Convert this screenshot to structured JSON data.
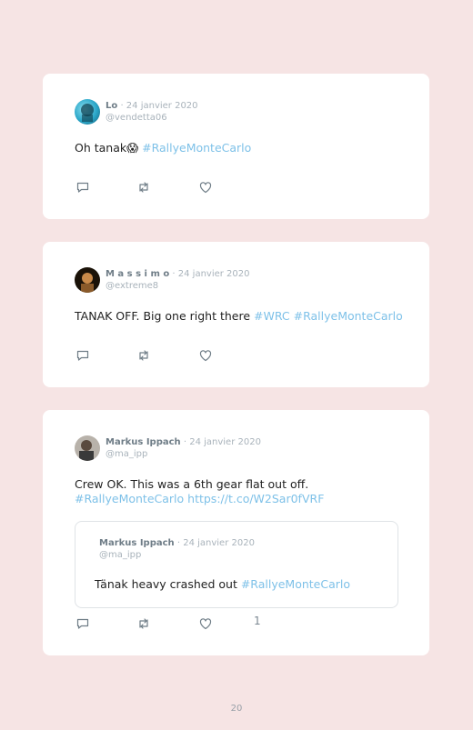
{
  "tweets": [
    {
      "name": "Lo",
      "date": "· 24 janvier 2020",
      "handle": "@vendetta06",
      "text": "Oh tanak😱 ",
      "tags": "#RallyeMonteCarlo"
    },
    {
      "name": "M a s s i m o",
      "date": "· 24 janvier 2020",
      "handle": "@extreme8",
      "text": "TANAK OFF. Big one right there ",
      "tags": "#WRC #RallyeMonteCarlo"
    },
    {
      "name": "Markus Ippach",
      "date": "· 24 janvier 2020",
      "handle": "@ma_ipp",
      "text": "Crew OK. This was a 6th gear flat out off.",
      "tags": "#RallyeMonteCarlo https://t.co/W2Sar0fVRF",
      "likes": "1",
      "quote": {
        "name": "Markus Ippach",
        "date": "· 24 janvier 2020",
        "handle": "@ma_ipp",
        "text": "Tänak heavy crashed out ",
        "tags": "#RallyeMonteCarlo"
      }
    }
  ],
  "icons": [
    "reply-icon",
    "retweet-icon",
    "like-icon"
  ],
  "colors": {
    "background": "#f6e4e4",
    "hashtag": "#7ec1e8",
    "card": "#ffffff"
  },
  "page_number": "20"
}
